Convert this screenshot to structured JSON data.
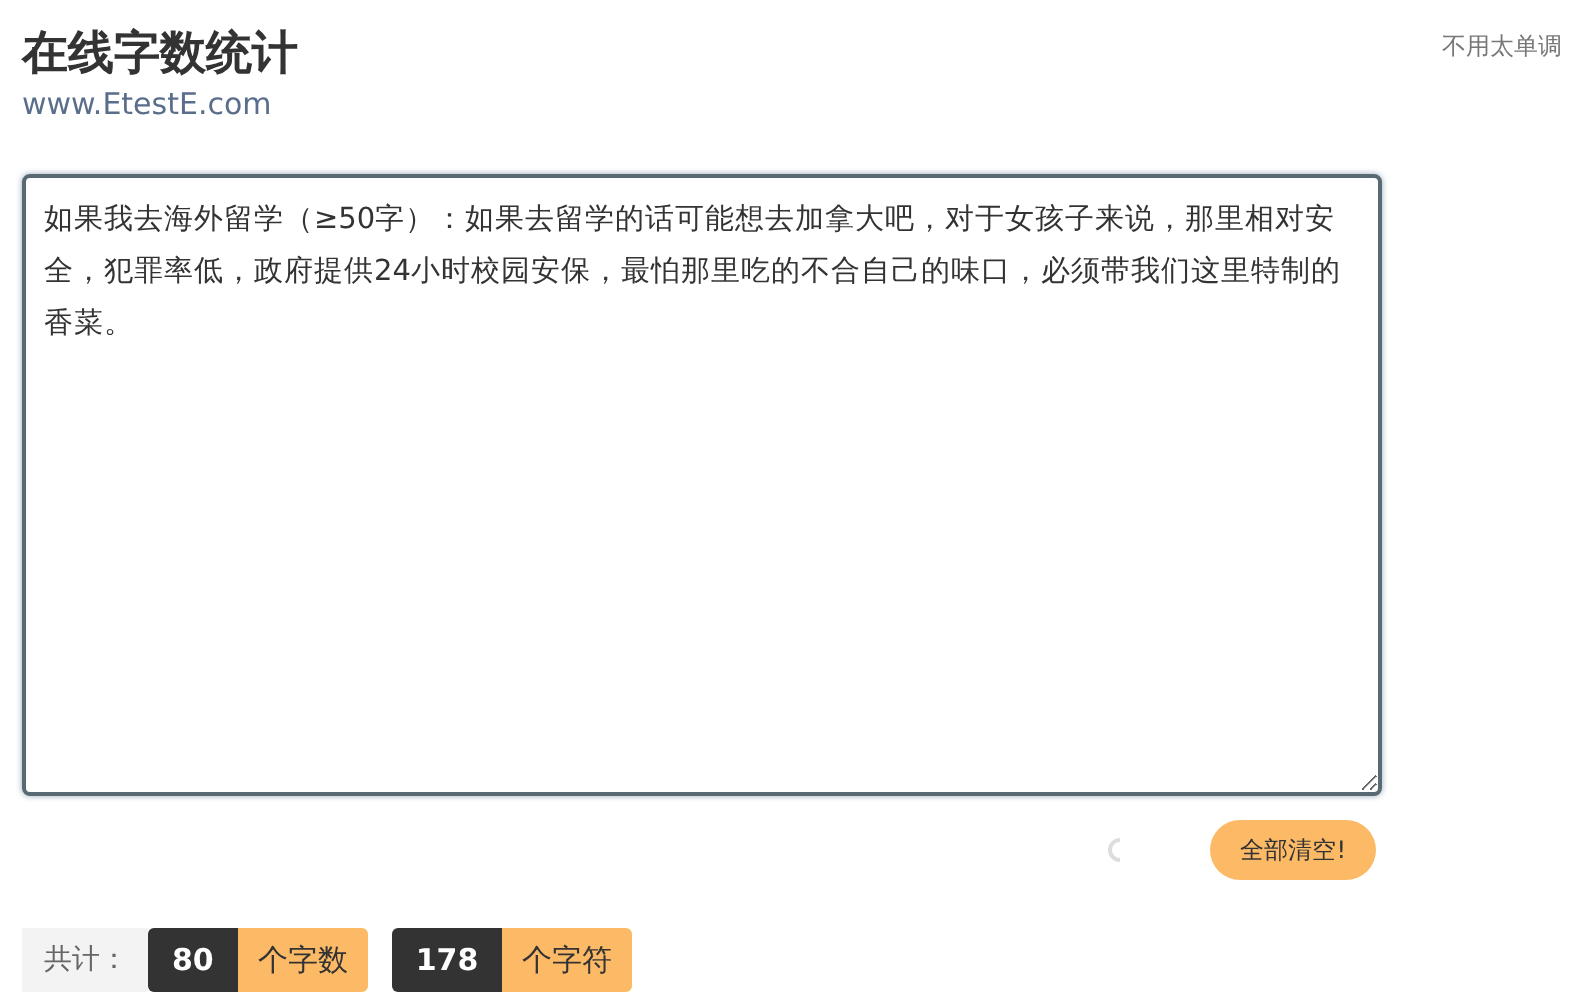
{
  "header": {
    "title": "在线字数统计",
    "subtitle": "www.EtestE.com",
    "tagline": "不用太单调"
  },
  "editor": {
    "value": "如果我去海外留学（≥50字）：如果去留学的话可能想去加拿大吧，对于女孩子来说，那里相对安全，犯罪率低，政府提供24小时校园安保，最怕那里吃的不合自己的味口，必须带我们这里特制的香菜。"
  },
  "actions": {
    "clear_button": "全部清空!"
  },
  "stats": {
    "label": "共计：",
    "items": [
      {
        "count": "80",
        "unit": "个字数"
      },
      {
        "count": "178",
        "unit": "个字符"
      }
    ]
  }
}
